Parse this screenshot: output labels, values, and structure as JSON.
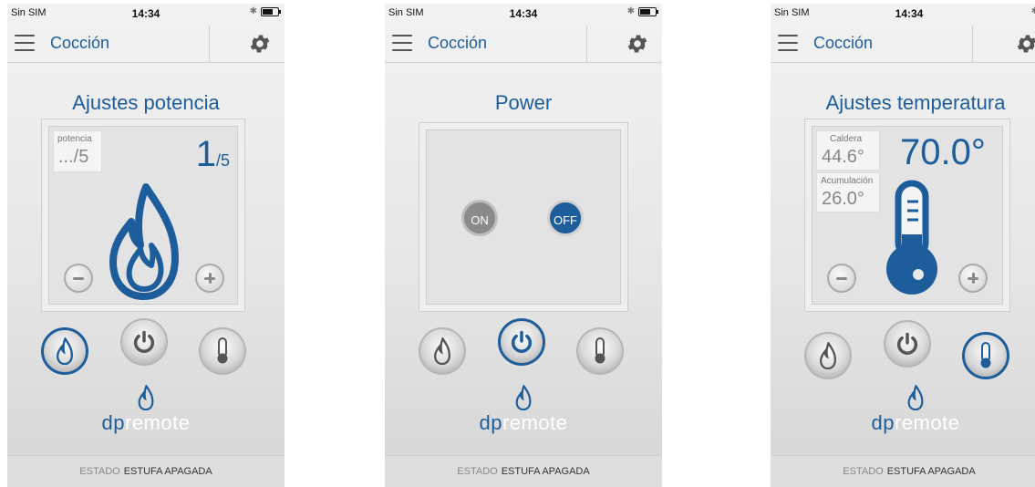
{
  "screens": [
    {
      "status": {
        "carrier": "Sin SIM",
        "time": "14:34"
      },
      "nav": {
        "title": "Cocción"
      },
      "panel_title": "Ajustes potencia",
      "potencia": {
        "label": "potencia",
        "current": ".../5",
        "value": "1",
        "denominator": "/5"
      },
      "footer": {
        "key": "ESTADO",
        "value": "ESTUFA APAGADA"
      },
      "logo": {
        "dp": "dp",
        "rest": "remote"
      },
      "active_tab": "flame"
    },
    {
      "status": {
        "carrier": "Sin SIM",
        "time": "14:34"
      },
      "nav": {
        "title": "Cocción"
      },
      "panel_title": "Power",
      "power": {
        "on_label": "ON",
        "off_label": "OFF",
        "selected": "OFF"
      },
      "footer": {
        "key": "ESTADO",
        "value": "ESTUFA APAGADA"
      },
      "logo": {
        "dp": "dp",
        "rest": "remote"
      },
      "active_tab": "power"
    },
    {
      "status": {
        "carrier": "Sin SIM",
        "time": "14:34"
      },
      "nav": {
        "title": "Cocción"
      },
      "panel_title": "Ajustes temperatura",
      "temperature": {
        "caldera_label": "Caldera",
        "caldera_value": "44.6°",
        "acumulacion_label": "Acumulación",
        "acumulacion_value": "26.0°",
        "setpoint": "70.0°"
      },
      "footer": {
        "key": "ESTADO",
        "value": "ESTUFA APAGADA"
      },
      "logo": {
        "dp": "dp",
        "rest": "remote"
      },
      "active_tab": "thermometer"
    }
  ],
  "colors": {
    "accent": "#1d5d9b",
    "off_button": "#1d5d9b",
    "on_button": "#8a8a8a"
  },
  "icons": [
    "menu-icon",
    "gear-icon",
    "flame-icon",
    "power-icon",
    "thermometer-icon",
    "minus-icon",
    "plus-icon",
    "bluetooth-icon",
    "wifi-icon"
  ]
}
